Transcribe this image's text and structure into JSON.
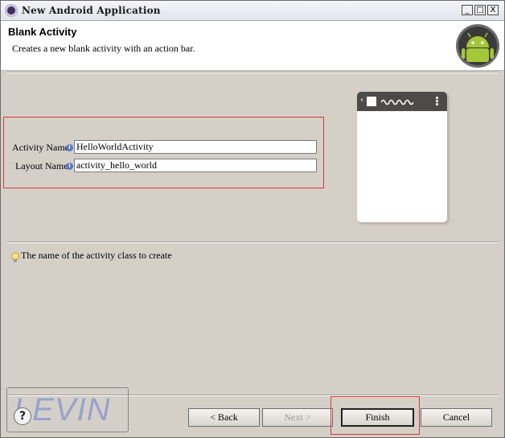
{
  "window": {
    "title": "New Android Application",
    "min_label": "_",
    "max_label": "□",
    "close_label": "X"
  },
  "header": {
    "title": "Blank Activity",
    "description": "Creates a new blank activity with an action bar."
  },
  "form": {
    "activity_name_label": "Activity Name",
    "activity_name_value": "HelloWorldActivity",
    "layout_name_label": "Layout Name",
    "layout_name_value": "activity_hello_world",
    "info_glyph": "i"
  },
  "hint": {
    "text": "The name of the activity class to create"
  },
  "footer": {
    "help_glyph": "?",
    "watermark": "LEVIN",
    "back_label": "< Back",
    "next_label": "Next >",
    "finish_label": "Finish",
    "cancel_label": "Cancel"
  },
  "colors": {
    "dialog_background": "#d4d0c8",
    "highlight_red": "#d7373f",
    "android_green": "#a4c639",
    "phone_bar": "#4d4b49"
  },
  "icons": {
    "app": "eclipse-icon",
    "logo": "android-logo-icon",
    "hint": "lightbulb-icon",
    "help": "help-icon"
  }
}
